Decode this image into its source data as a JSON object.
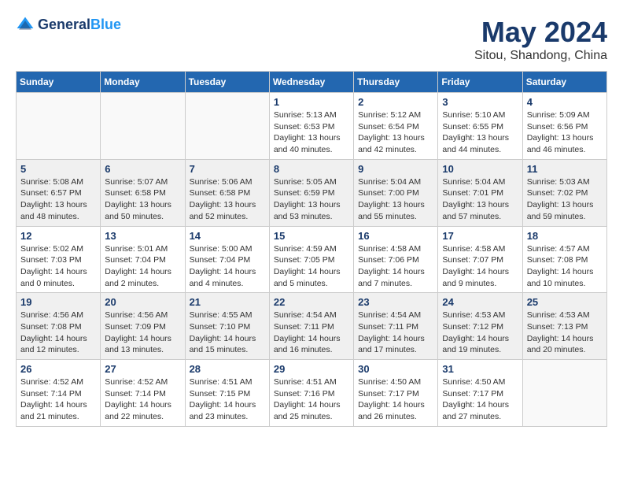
{
  "header": {
    "logo_line1": "General",
    "logo_line2": "Blue",
    "month": "May 2024",
    "location": "Sitou, Shandong, China"
  },
  "weekdays": [
    "Sunday",
    "Monday",
    "Tuesday",
    "Wednesday",
    "Thursday",
    "Friday",
    "Saturday"
  ],
  "weeks": [
    [
      {
        "day": "",
        "info": ""
      },
      {
        "day": "",
        "info": ""
      },
      {
        "day": "",
        "info": ""
      },
      {
        "day": "1",
        "info": "Sunrise: 5:13 AM\nSunset: 6:53 PM\nDaylight: 13 hours\nand 40 minutes."
      },
      {
        "day": "2",
        "info": "Sunrise: 5:12 AM\nSunset: 6:54 PM\nDaylight: 13 hours\nand 42 minutes."
      },
      {
        "day": "3",
        "info": "Sunrise: 5:10 AM\nSunset: 6:55 PM\nDaylight: 13 hours\nand 44 minutes."
      },
      {
        "day": "4",
        "info": "Sunrise: 5:09 AM\nSunset: 6:56 PM\nDaylight: 13 hours\nand 46 minutes."
      }
    ],
    [
      {
        "day": "5",
        "info": "Sunrise: 5:08 AM\nSunset: 6:57 PM\nDaylight: 13 hours\nand 48 minutes."
      },
      {
        "day": "6",
        "info": "Sunrise: 5:07 AM\nSunset: 6:58 PM\nDaylight: 13 hours\nand 50 minutes."
      },
      {
        "day": "7",
        "info": "Sunrise: 5:06 AM\nSunset: 6:58 PM\nDaylight: 13 hours\nand 52 minutes."
      },
      {
        "day": "8",
        "info": "Sunrise: 5:05 AM\nSunset: 6:59 PM\nDaylight: 13 hours\nand 53 minutes."
      },
      {
        "day": "9",
        "info": "Sunrise: 5:04 AM\nSunset: 7:00 PM\nDaylight: 13 hours\nand 55 minutes."
      },
      {
        "day": "10",
        "info": "Sunrise: 5:04 AM\nSunset: 7:01 PM\nDaylight: 13 hours\nand 57 minutes."
      },
      {
        "day": "11",
        "info": "Sunrise: 5:03 AM\nSunset: 7:02 PM\nDaylight: 13 hours\nand 59 minutes."
      }
    ],
    [
      {
        "day": "12",
        "info": "Sunrise: 5:02 AM\nSunset: 7:03 PM\nDaylight: 14 hours\nand 0 minutes."
      },
      {
        "day": "13",
        "info": "Sunrise: 5:01 AM\nSunset: 7:04 PM\nDaylight: 14 hours\nand 2 minutes."
      },
      {
        "day": "14",
        "info": "Sunrise: 5:00 AM\nSunset: 7:04 PM\nDaylight: 14 hours\nand 4 minutes."
      },
      {
        "day": "15",
        "info": "Sunrise: 4:59 AM\nSunset: 7:05 PM\nDaylight: 14 hours\nand 5 minutes."
      },
      {
        "day": "16",
        "info": "Sunrise: 4:58 AM\nSunset: 7:06 PM\nDaylight: 14 hours\nand 7 minutes."
      },
      {
        "day": "17",
        "info": "Sunrise: 4:58 AM\nSunset: 7:07 PM\nDaylight: 14 hours\nand 9 minutes."
      },
      {
        "day": "18",
        "info": "Sunrise: 4:57 AM\nSunset: 7:08 PM\nDaylight: 14 hours\nand 10 minutes."
      }
    ],
    [
      {
        "day": "19",
        "info": "Sunrise: 4:56 AM\nSunset: 7:08 PM\nDaylight: 14 hours\nand 12 minutes."
      },
      {
        "day": "20",
        "info": "Sunrise: 4:56 AM\nSunset: 7:09 PM\nDaylight: 14 hours\nand 13 minutes."
      },
      {
        "day": "21",
        "info": "Sunrise: 4:55 AM\nSunset: 7:10 PM\nDaylight: 14 hours\nand 15 minutes."
      },
      {
        "day": "22",
        "info": "Sunrise: 4:54 AM\nSunset: 7:11 PM\nDaylight: 14 hours\nand 16 minutes."
      },
      {
        "day": "23",
        "info": "Sunrise: 4:54 AM\nSunset: 7:11 PM\nDaylight: 14 hours\nand 17 minutes."
      },
      {
        "day": "24",
        "info": "Sunrise: 4:53 AM\nSunset: 7:12 PM\nDaylight: 14 hours\nand 19 minutes."
      },
      {
        "day": "25",
        "info": "Sunrise: 4:53 AM\nSunset: 7:13 PM\nDaylight: 14 hours\nand 20 minutes."
      }
    ],
    [
      {
        "day": "26",
        "info": "Sunrise: 4:52 AM\nSunset: 7:14 PM\nDaylight: 14 hours\nand 21 minutes."
      },
      {
        "day": "27",
        "info": "Sunrise: 4:52 AM\nSunset: 7:14 PM\nDaylight: 14 hours\nand 22 minutes."
      },
      {
        "day": "28",
        "info": "Sunrise: 4:51 AM\nSunset: 7:15 PM\nDaylight: 14 hours\nand 23 minutes."
      },
      {
        "day": "29",
        "info": "Sunrise: 4:51 AM\nSunset: 7:16 PM\nDaylight: 14 hours\nand 25 minutes."
      },
      {
        "day": "30",
        "info": "Sunrise: 4:50 AM\nSunset: 7:17 PM\nDaylight: 14 hours\nand 26 minutes."
      },
      {
        "day": "31",
        "info": "Sunrise: 4:50 AM\nSunset: 7:17 PM\nDaylight: 14 hours\nand 27 minutes."
      },
      {
        "day": "",
        "info": ""
      }
    ]
  ]
}
